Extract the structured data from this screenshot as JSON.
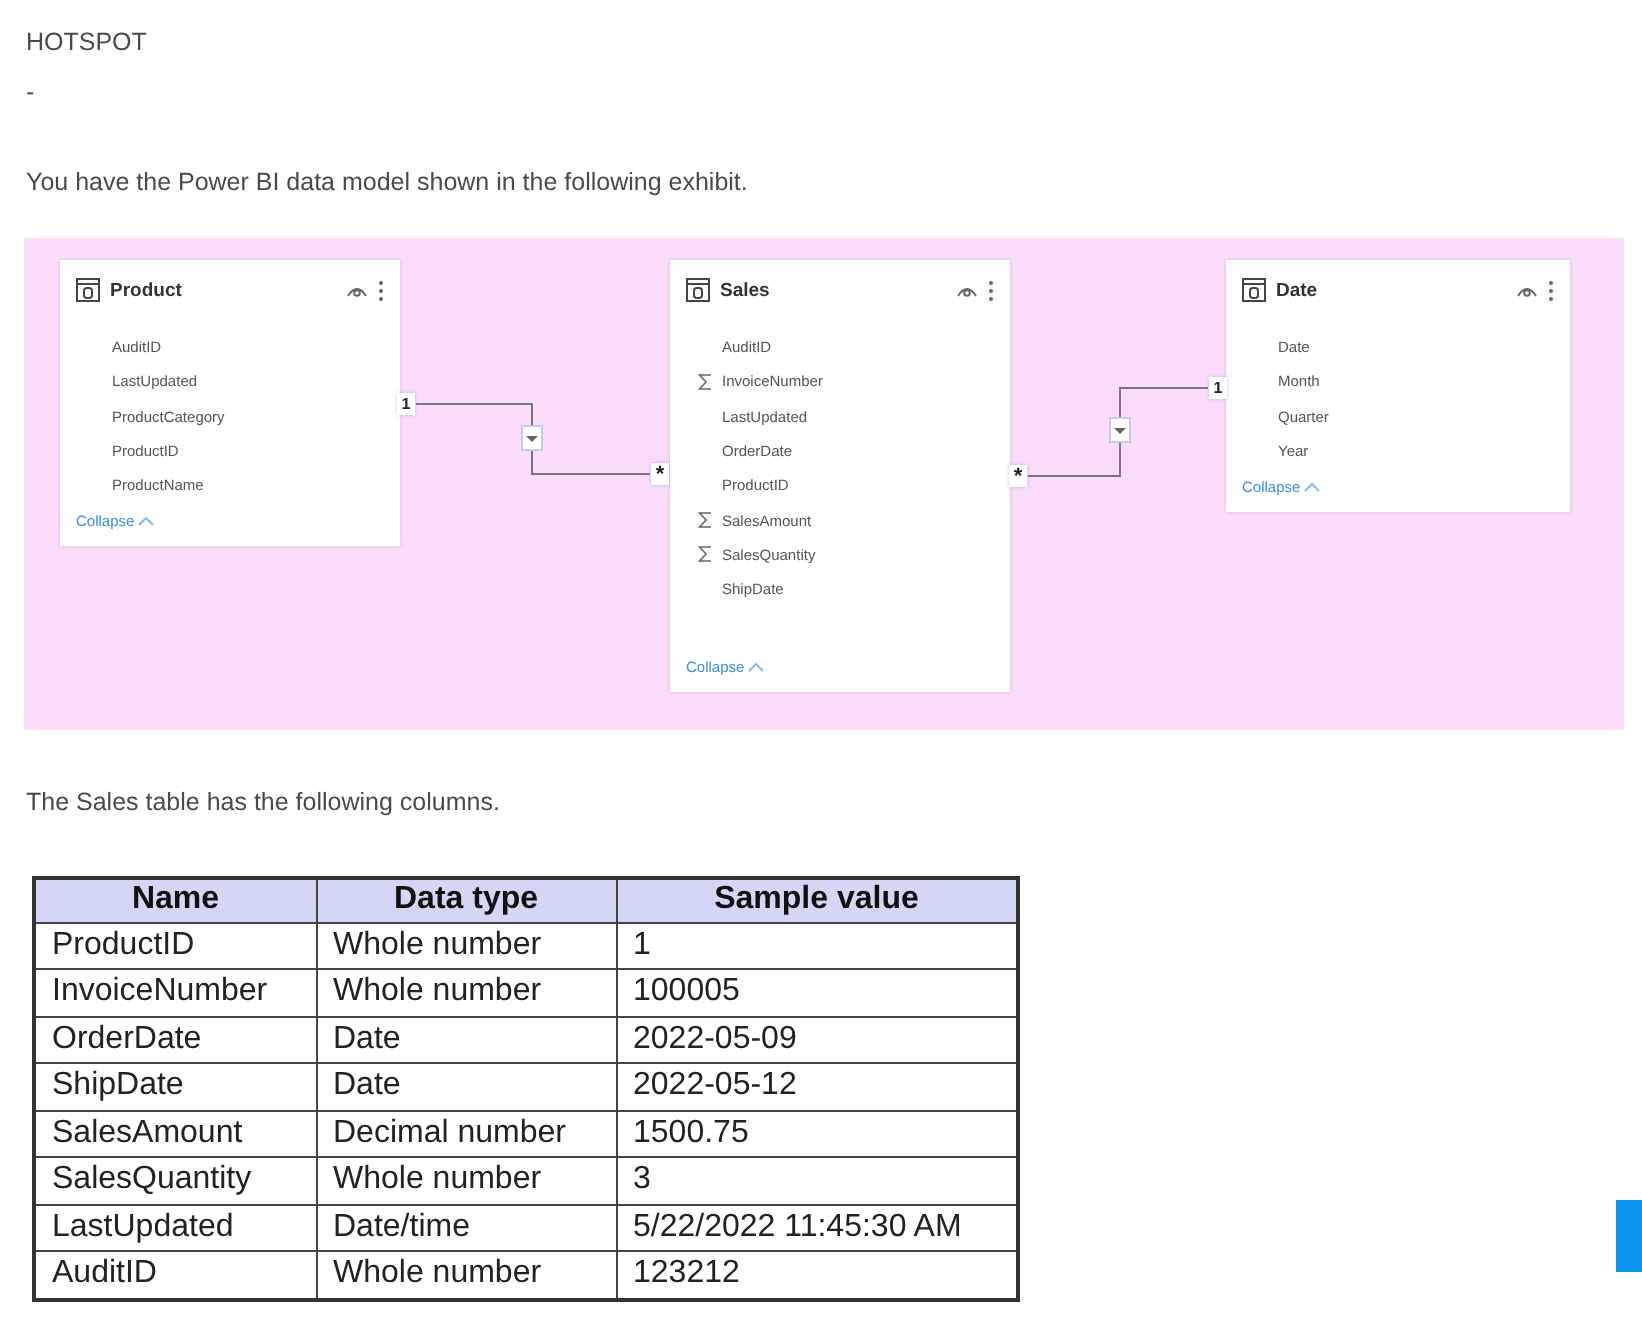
{
  "heading": "HOTSPOT",
  "separator": "-",
  "intro": "You have the Power BI data model shown in the following exhibit.",
  "model": {
    "tables": [
      {
        "title": "Product",
        "collapse": "Collapse",
        "fields": [
          {
            "name": "AuditID",
            "aggregated": false
          },
          {
            "name": "LastUpdated",
            "aggregated": false
          },
          {
            "name": "ProductCategory",
            "aggregated": false
          },
          {
            "name": "ProductID",
            "aggregated": false
          },
          {
            "name": "ProductName",
            "aggregated": false
          }
        ]
      },
      {
        "title": "Sales",
        "collapse": "Collapse",
        "fields": [
          {
            "name": "AuditID",
            "aggregated": false
          },
          {
            "name": "InvoiceNumber",
            "aggregated": true
          },
          {
            "name": "LastUpdated",
            "aggregated": false
          },
          {
            "name": "OrderDate",
            "aggregated": false
          },
          {
            "name": "ProductID",
            "aggregated": false
          },
          {
            "name": "SalesAmount",
            "aggregated": true
          },
          {
            "name": "SalesQuantity",
            "aggregated": true
          },
          {
            "name": "ShipDate",
            "aggregated": false
          }
        ]
      },
      {
        "title": "Date",
        "collapse": "Collapse",
        "fields": [
          {
            "name": "Date",
            "aggregated": false
          },
          {
            "name": "Month",
            "aggregated": false
          },
          {
            "name": "Quarter",
            "aggregated": false
          },
          {
            "name": "Year",
            "aggregated": false
          }
        ]
      }
    ],
    "relationships": [
      {
        "one": "1",
        "many": "*"
      },
      {
        "one": "1",
        "many": "*"
      }
    ]
  },
  "table_intro": "The Sales table has the following columns.",
  "table": {
    "columns": [
      "Name",
      "Data type",
      "Sample value"
    ],
    "rows": [
      [
        "ProductID",
        "Whole number",
        "1"
      ],
      [
        "InvoiceNumber",
        "Whole number",
        "100005"
      ],
      [
        "OrderDate",
        "Date",
        "2022-05-09"
      ],
      [
        "ShipDate",
        "Date",
        "2022-05-12"
      ],
      [
        "SalesAmount",
        "Decimal number",
        "1500.75"
      ],
      [
        "SalesQuantity",
        "Whole number",
        "3"
      ],
      [
        "LastUpdated",
        "Date/time",
        "5/22/2022 11:45:30 AM"
      ],
      [
        "AuditID",
        "Whole number",
        "123212"
      ]
    ]
  }
}
